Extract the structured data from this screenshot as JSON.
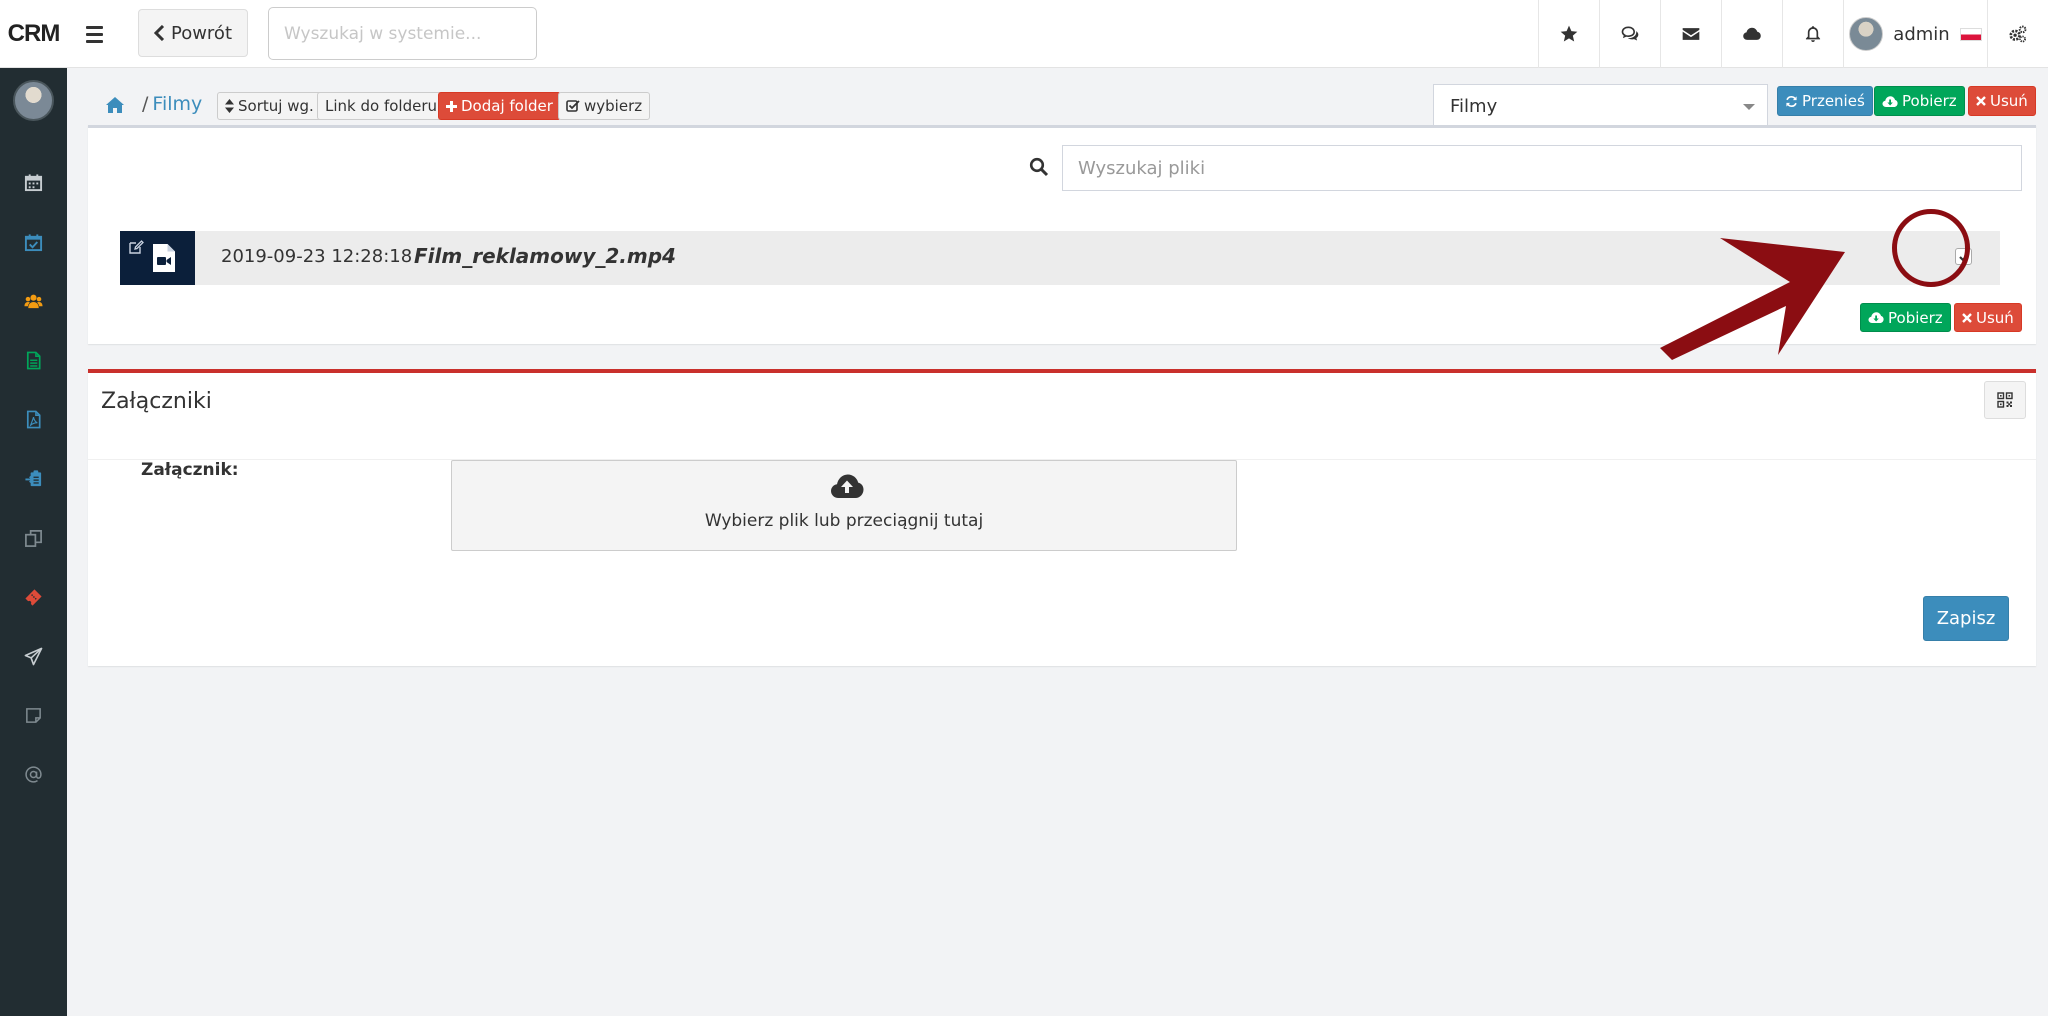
{
  "app": {
    "brand": "CRM"
  },
  "topbar": {
    "back_label": "Powrót",
    "search_placeholder": "Wyszukaj w systemie...",
    "username": "admin"
  },
  "icons": {
    "top": [
      "star-icon",
      "comments-icon",
      "envelope-icon",
      "cloud-icon",
      "bell-icon",
      "gears-icon"
    ],
    "sidebar": [
      "calendar-icon",
      "calendar-check-icon",
      "users-icon",
      "document-icon",
      "pdf-icon",
      "clipboard-icon",
      "copy-icon",
      "ticket-icon",
      "paper-plane-icon",
      "note-icon",
      "at-icon"
    ]
  },
  "colors": {
    "primary": "#3c8dbc",
    "success": "#00a65a",
    "danger": "#dd4b39",
    "sidebar_bg": "#222d32",
    "annotation": "#8b0d12"
  },
  "toolbar": {
    "crumb": "Filmy",
    "sort_label": "Sortuj wg.",
    "link_label": "Link do folderu",
    "add_folder_label": "Dodaj folder",
    "select_label": "wybierz",
    "folder_select": "Filmy",
    "move_label": "Przenieś",
    "download_label": "Pobierz",
    "delete_label": "Usuń"
  },
  "files": {
    "search_placeholder": "Wyszukaj pliki",
    "items": [
      {
        "date": "2019-09-23 12:28:18",
        "name": "Film_reklamowy_2.mp4",
        "checked": true
      }
    ],
    "download_label": "Pobierz",
    "delete_label": "Usuń"
  },
  "attachments": {
    "title": "Załączniki",
    "label": "Załącznik:",
    "dropzone_text": "Wybierz plik  lub  przeciągnij tutaj",
    "save_label": "Zapisz"
  }
}
